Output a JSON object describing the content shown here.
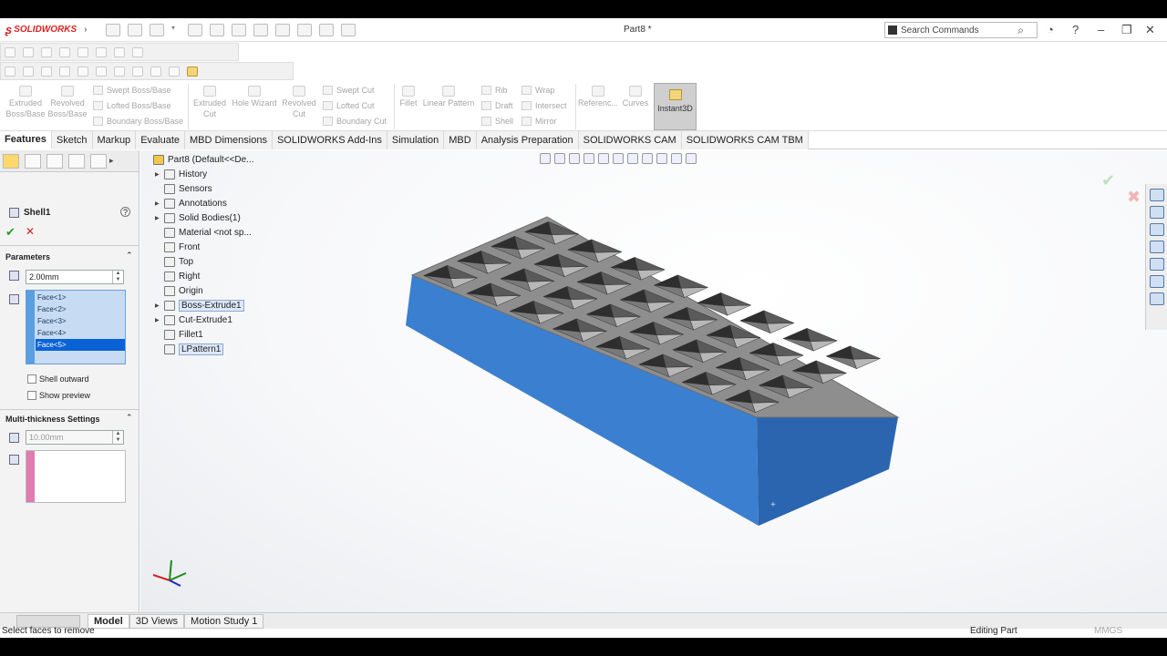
{
  "app": {
    "brand": "SOLIDWORKS",
    "doc_title": "Part8 *",
    "search_placeholder": "Search Commands"
  },
  "command_manager": {
    "extruded_boss": "Extruded Boss/Base",
    "revolved_boss": "Revolved Boss/Base",
    "swept_boss": "Swept Boss/Base",
    "lofted_boss": "Lofted Boss/Base",
    "boundary_boss": "Boundary Boss/Base",
    "extruded_cut": "Extruded Cut",
    "hole_wizard": "Hole Wizard",
    "revolved_cut": "Revolved Cut",
    "swept_cut": "Swept Cut",
    "lofted_cut": "Lofted Cut",
    "boundary_cut": "Boundary Cut",
    "fillet": "Fillet",
    "linear_pattern": "Linear Pattern",
    "rib": "Rib",
    "draft": "Draft",
    "shell": "Shell",
    "wrap": "Wrap",
    "intersect": "Intersect",
    "mirror": "Mirror",
    "reference": "Referenc...",
    "curves": "Curves",
    "instant3d": "Instant3D"
  },
  "tabs": [
    "Features",
    "Sketch",
    "Markup",
    "Evaluate",
    "MBD Dimensions",
    "SOLIDWORKS Add-Ins",
    "Simulation",
    "MBD",
    "Analysis Preparation",
    "SOLIDWORKS CAM",
    "SOLIDWORKS CAM TBM"
  ],
  "property_manager": {
    "feature_title": "Shell1",
    "parameters_header": "Parameters",
    "thickness": "2.00mm",
    "faces": [
      "Face<1>",
      "Face<2>",
      "Face<3>",
      "Face<4>",
      "Face<5>"
    ],
    "shell_outward": "Shell outward",
    "show_preview": "Show preview",
    "multi_header": "Multi-thickness Settings",
    "multi_thickness": "10.00mm"
  },
  "feature_tree": {
    "root": "Part8  (Default<<De...",
    "items": [
      "History",
      "Sensors",
      "Annotations",
      "Solid Bodies(1)",
      "Material <not sp...",
      "Front",
      "Top",
      "Right",
      "Origin",
      "Boss-Extrude1",
      "Cut-Extrude1",
      "Fillet1",
      "LPattern1"
    ]
  },
  "bottom_tabs": [
    "Model",
    "3D Views",
    "Motion Study 1"
  ],
  "status": {
    "message": "Select faces to remove",
    "mode": "Editing Part",
    "units": "MMGS"
  },
  "colors": {
    "part_blue": "#3b7fd0",
    "part_top": "#8e8e8e",
    "accent_pink": "#e27bb0",
    "selection_blue": "#0a63d6"
  }
}
